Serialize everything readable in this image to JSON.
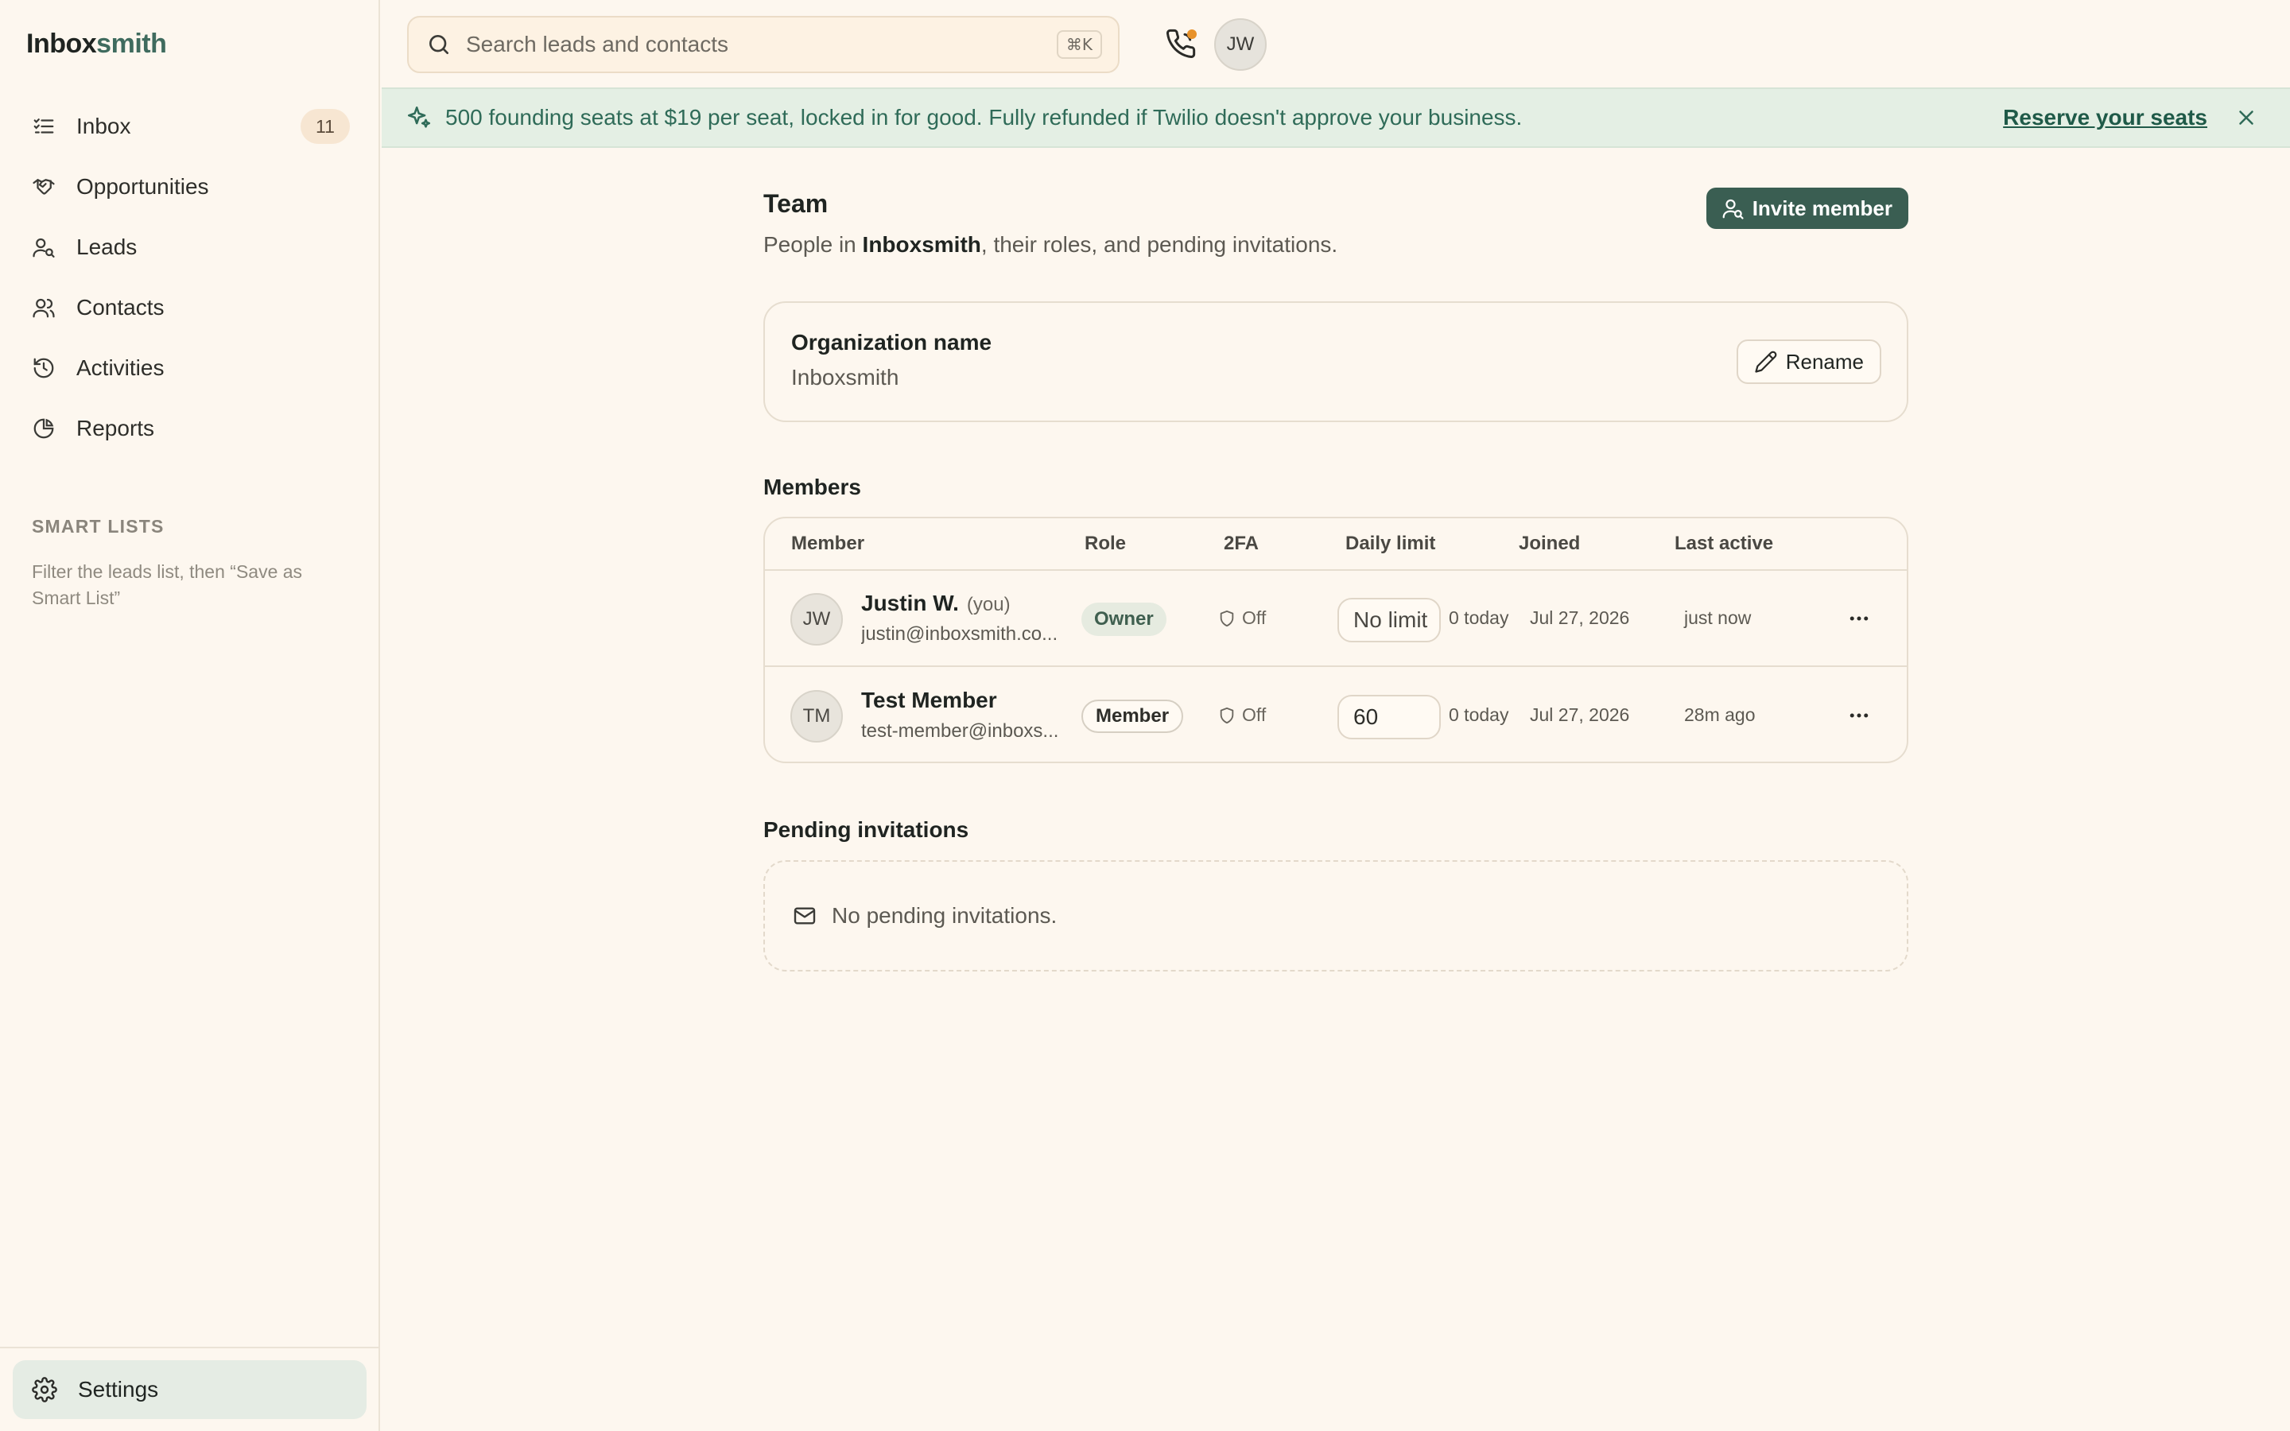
{
  "app": {
    "logo_part1": "Inbox",
    "logo_part2": "smith"
  },
  "sidebar": {
    "items": [
      {
        "label": "Inbox",
        "icon": "inbox-list-icon",
        "badge": "11"
      },
      {
        "label": "Opportunities",
        "icon": "handshake-icon"
      },
      {
        "label": "Leads",
        "icon": "user-search-icon"
      },
      {
        "label": "Contacts",
        "icon": "users-icon"
      },
      {
        "label": "Activities",
        "icon": "history-icon"
      },
      {
        "label": "Reports",
        "icon": "pie-chart-icon"
      }
    ],
    "smart_lists_title": "SMART LISTS",
    "smart_lists_desc": "Filter the leads list, then “Save as Smart List”",
    "settings_label": "Settings"
  },
  "topbar": {
    "search_placeholder": "Search leads and contacts",
    "shortcut": "⌘K",
    "avatar_initials": "JW"
  },
  "banner": {
    "text": "500 founding seats at $19 per seat, locked in for good. Fully refunded if Twilio doesn't approve your business.",
    "link": "Reserve your seats"
  },
  "page": {
    "title": "Team",
    "subtitle_pre": "People in ",
    "subtitle_org": "Inboxsmith",
    "subtitle_post": ", their roles, and pending invitations.",
    "invite_label": "Invite member"
  },
  "org": {
    "label": "Organization name",
    "value": "Inboxsmith",
    "rename_label": "Rename"
  },
  "members": {
    "title": "Members",
    "headers": {
      "member": "Member",
      "role": "Role",
      "twofa": "2FA",
      "daily_limit": "Daily limit",
      "joined": "Joined",
      "last_active": "Last active"
    },
    "rows": [
      {
        "initials": "JW",
        "name": "Justin W.",
        "you": "(you)",
        "email": "justin@inboxsmith.co...",
        "role": "Owner",
        "twofa": "Off",
        "limit_placeholder": "No limit",
        "today": "0 today",
        "joined": "Jul 27, 2026",
        "last_active": "just now"
      },
      {
        "initials": "TM",
        "name": "Test Member",
        "email": "test-member@inboxs...",
        "role": "Member",
        "twofa": "Off",
        "limit_value": "60",
        "today": "0 today",
        "joined": "Jul 27, 2026",
        "last_active": "28m ago"
      }
    ]
  },
  "pending": {
    "title": "Pending invitations",
    "empty_text": "No pending invitations."
  },
  "colors": {
    "background": "#fdf7ef",
    "accent": "#3a5e52",
    "banner_bg": "#e4efe4",
    "banner_text": "#2f6b58",
    "notification_dot": "#e8922a"
  }
}
